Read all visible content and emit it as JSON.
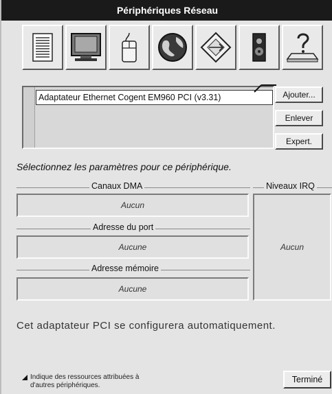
{
  "window": {
    "title": "Périphériques Réseau"
  },
  "toolbar": {
    "icons": [
      "document-icon",
      "monitor-icon",
      "mouse-icon",
      "globe-icon",
      "network-diamond-icon",
      "speaker-icon",
      "help-printer-icon"
    ]
  },
  "adapters": {
    "items": [
      "Adaptateur Ethernet Cogent EM960 PCI (v3.31)"
    ]
  },
  "buttons": {
    "add": "Ajouter...",
    "remove": "Enlever",
    "expert": "Expert.",
    "done": "Terminé"
  },
  "instruction": "Sélectionnez les paramètres pour ce périphérique.",
  "groups": {
    "dma": {
      "title": "Canaux DMA",
      "value": "Aucun"
    },
    "port": {
      "title": "Adresse du port",
      "value": "Aucune"
    },
    "memory": {
      "title": "Adresse mémoire",
      "value": "Aucune"
    },
    "irq": {
      "title": "Niveaux IRQ",
      "value": "Aucun"
    }
  },
  "auto_message": "Cet adaptateur PCI se configurera automatiquement.",
  "legend": {
    "line1": "Indique des ressources attribuées à",
    "line2": "d'autres périphériques."
  }
}
